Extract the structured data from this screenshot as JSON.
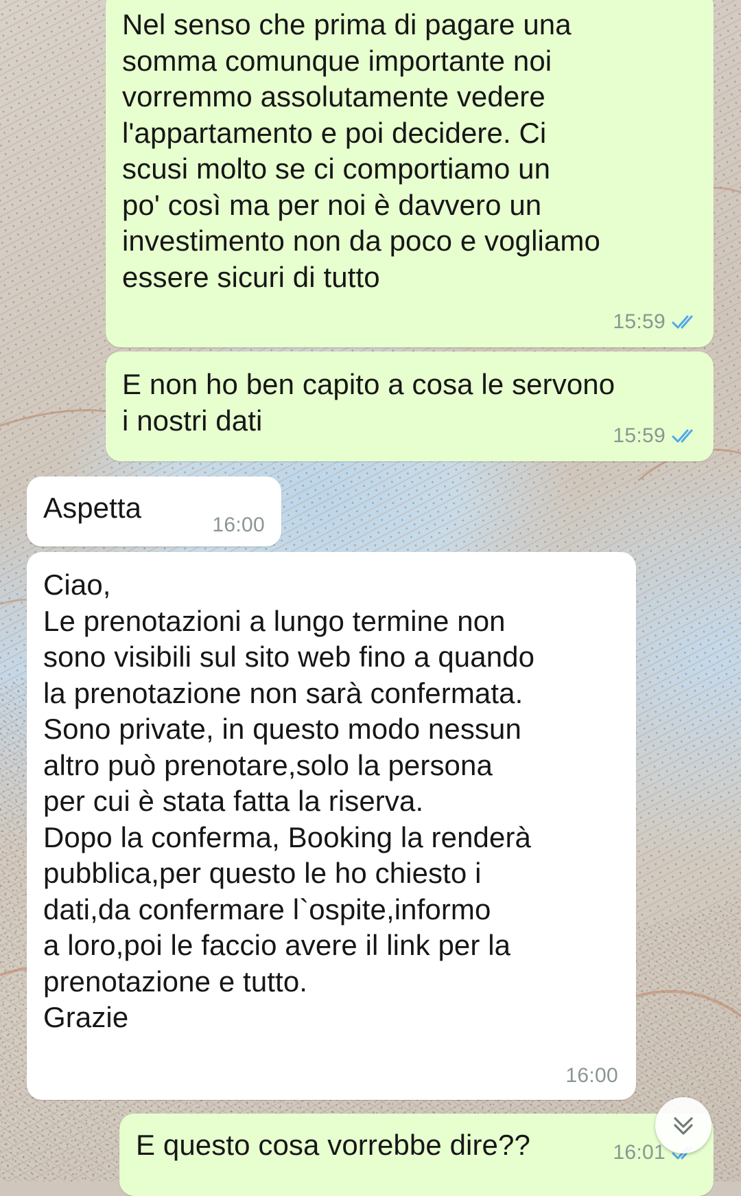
{
  "chat": {
    "messages": [
      {
        "direction": "outgoing",
        "text": "Nel senso che prima di pagare una\nsomma comunque importante noi\nvorremmo assolutamente vedere\nl'appartamento e poi decidere. Ci\nscusi molto se ci comportiamo un\npo' così ma per noi è davvero un\ninvestimento non da poco e vogliamo\nessere sicuri di tutto",
        "time": "15:59",
        "status": "read"
      },
      {
        "direction": "outgoing",
        "text": "E non ho ben capito a cosa le servono\ni nostri dati",
        "time": "15:59",
        "status": "read"
      },
      {
        "direction": "incoming",
        "text": "Aspetta",
        "time": "16:00"
      },
      {
        "direction": "incoming",
        "text": "Ciao,\nLe prenotazioni a lungo termine non\nsono visibili sul sito web fino a quando\nla prenotazione non sarà confermata.\nSono private, in questo modo nessun\naltro può prenotare,solo la persona\nper cui è stata fatta la riserva.\nDopo la conferma, Booking la renderà\npubblica,per questo le ho chiesto i\ndati,da confermare l`ospite,informo\na loro,poi le faccio avere il link per la\nprenotazione e tutto.\nGrazie",
        "time": "16:00"
      },
      {
        "direction": "outgoing",
        "text": "E questo cosa vorrebbe dire??",
        "time": "16:01",
        "status": "read"
      }
    ]
  },
  "icons": {
    "read_ticks": "double-check-icon",
    "scroll_down": "double-chevron-down-icon"
  },
  "colors": {
    "outgoing_bubble": "#e7fecf",
    "incoming_bubble": "#ffffff",
    "read_ticks": "#4fa9e8",
    "timestamp": "#8a9690",
    "text": "#161616"
  }
}
